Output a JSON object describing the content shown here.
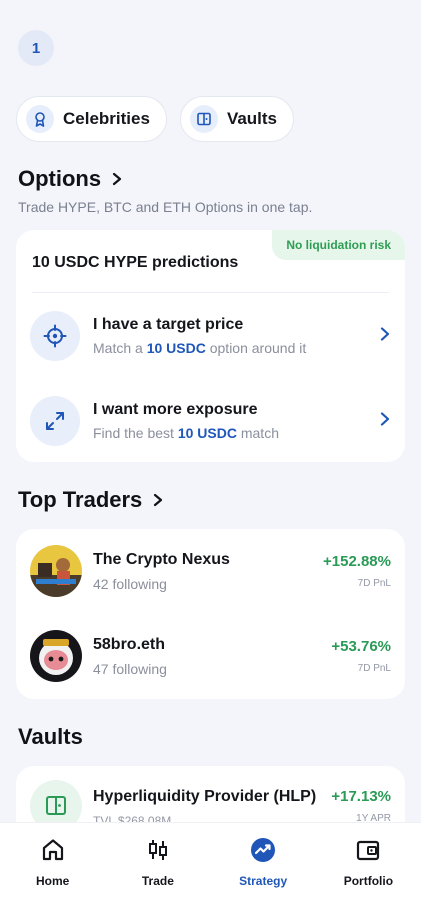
{
  "page_badge": "1",
  "chips": [
    {
      "label": "Celebrities",
      "icon": "award-icon"
    },
    {
      "label": "Vaults",
      "icon": "vault-icon"
    }
  ],
  "options": {
    "title": "Options",
    "subtitle": "Trade HYPE, BTC and ETH Options in one tap.",
    "badge": "No liquidation risk",
    "card_title": "10 USDC HYPE predictions",
    "rows": [
      {
        "title": "I have a target price",
        "sub_prefix": "Match a ",
        "sub_highlight": "10 USDC",
        "sub_suffix": " option around it",
        "icon": "crosshair-icon"
      },
      {
        "title": "I want more exposure",
        "sub_prefix": "Find the best ",
        "sub_highlight": "10 USDC",
        "sub_suffix": " match",
        "icon": "expand-icon"
      }
    ]
  },
  "top_traders": {
    "title": "Top Traders",
    "items": [
      {
        "name": "The Crypto Nexus",
        "following": "42 following",
        "pnl": "+152.88%",
        "pnl_label": "7D PnL"
      },
      {
        "name": "58bro.eth",
        "following": "47 following",
        "pnl": "+53.76%",
        "pnl_label": "7D PnL"
      }
    ]
  },
  "vaults": {
    "title": "Vaults",
    "items": [
      {
        "name": "Hyperliquidity Provider (HLP)",
        "tvl": "TVL $268.08M",
        "apr": "+17.13%",
        "apr_label": "1Y APR"
      }
    ]
  },
  "nav": [
    {
      "label": "Home",
      "icon": "home-icon",
      "active": false
    },
    {
      "label": "Trade",
      "icon": "trade-icon",
      "active": false
    },
    {
      "label": "Strategy",
      "icon": "strategy-icon",
      "active": true
    },
    {
      "label": "Portfolio",
      "icon": "wallet-icon",
      "active": false
    }
  ],
  "colors": {
    "accent": "#1f56b8",
    "positive": "#2a9a56",
    "background": "#f3f5fa"
  }
}
